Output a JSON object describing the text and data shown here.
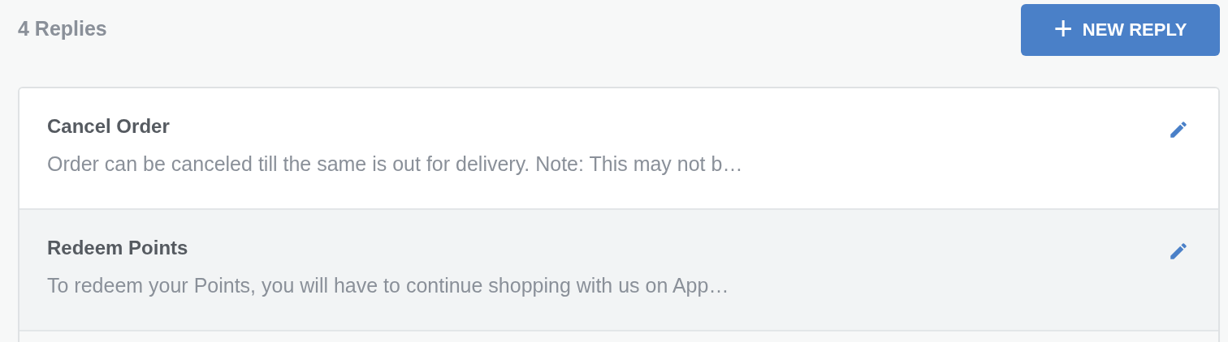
{
  "header": {
    "title": "4 Replies",
    "new_button": {
      "icon": "+",
      "label": "NEW REPLY"
    }
  },
  "replies": [
    {
      "title": "Cancel Order",
      "preview": "Order can be canceled till the same is out for delivery. Note: This may not b…",
      "selected": false
    },
    {
      "title": "Redeem Points",
      "preview": "To redeem your Points, you will have to continue shopping with us on App…",
      "selected": true
    }
  ]
}
